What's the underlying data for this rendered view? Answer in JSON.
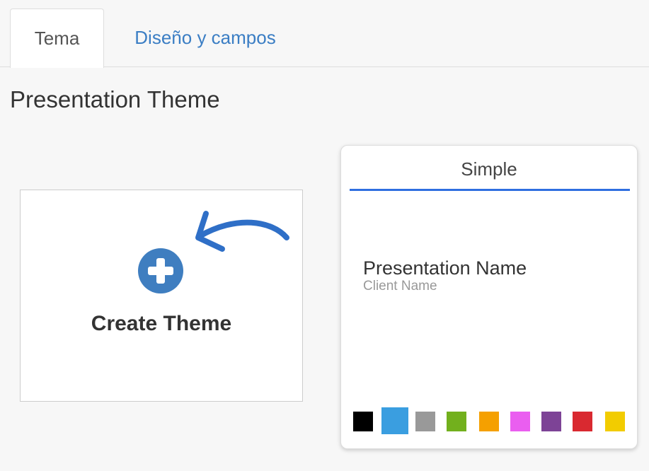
{
  "tabs": [
    {
      "label": "Tema",
      "active": true
    },
    {
      "label": "Diseño y campos",
      "active": false
    }
  ],
  "section_title": "Presentation Theme",
  "create_card": {
    "label": "Create Theme",
    "icon": "plus-circle-icon",
    "icon_color": "#3f7ec0"
  },
  "annotation": {
    "icon": "curved-arrow-icon",
    "color": "#2f6fc7"
  },
  "theme_card": {
    "name": "Simple",
    "accent_color": "#2f6fe0",
    "preview_title": "Presentation Name",
    "preview_subtitle": "Client Name",
    "selected_swatch": 1,
    "swatches": [
      {
        "name": "black",
        "color": "#000000"
      },
      {
        "name": "blue",
        "color": "#3a9ee0"
      },
      {
        "name": "gray",
        "color": "#999999"
      },
      {
        "name": "green",
        "color": "#72b01d"
      },
      {
        "name": "orange",
        "color": "#f5a000"
      },
      {
        "name": "magenta",
        "color": "#ea5ef0"
      },
      {
        "name": "purple",
        "color": "#7d4396"
      },
      {
        "name": "red",
        "color": "#d92930"
      },
      {
        "name": "yellow",
        "color": "#f2cc00"
      }
    ]
  }
}
